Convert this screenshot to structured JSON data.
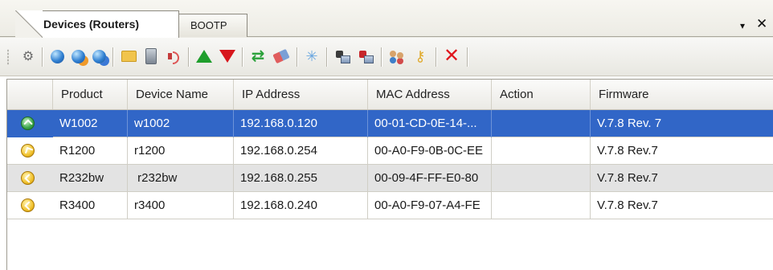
{
  "tabs": [
    {
      "label": "Devices (Routers)",
      "active": true
    },
    {
      "label": "BOOTP",
      "active": false
    }
  ],
  "window_controls": {
    "dropdown": "▾",
    "close": "✕"
  },
  "toolbar": {
    "icons": [
      "settings-tool-icon",
      "globe-icon",
      "globe-orange-icon",
      "globe-blue-icon",
      "folder-icon",
      "device-icon",
      "speaker-icon",
      "arrow-up-icon",
      "arrow-down-icon",
      "refresh-icon",
      "eraser-icon",
      "star-icon",
      "network-icon",
      "network-red-icon",
      "people-icon",
      "key-icon",
      "delete-icon"
    ]
  },
  "grid": {
    "columns": [
      "Product",
      "Device Name",
      "IP Address",
      "MAC Address",
      "Action",
      "Firmware"
    ],
    "rows": [
      {
        "status": "online",
        "product": "W1002",
        "device_name": "w1002",
        "ip": "192.168.0.120",
        "mac": "00-01-CD-0E-14-...",
        "action": "",
        "firmware": "V.7.8 Rev. 7",
        "selected": true
      },
      {
        "status": "warning",
        "product": "R1200",
        "device_name": "r1200",
        "ip": "192.168.0.254",
        "mac": "00-A0-F9-0B-0C-EE",
        "action": "",
        "firmware": "V.7.8 Rev.7",
        "selected": false
      },
      {
        "status": "warning",
        "product": "R232bw",
        "device_name": " r232bw",
        "ip": "192.168.0.255",
        "mac": "00-09-4F-FF-E0-80",
        "action": "",
        "firmware": "V.7.8 Rev.7",
        "selected": false
      },
      {
        "status": "warning",
        "product": "R3400",
        "device_name": "r3400",
        "ip": "192.168.0.240",
        "mac": "00-A0-F9-07-A4-FE",
        "action": "",
        "firmware": "V.7.8 Rev.7",
        "selected": false
      }
    ]
  },
  "colors": {
    "selection": "#3166c7",
    "alt_row": "#e3e3e3",
    "status_ok": "#3aa347",
    "status_warn": "#f1c12c"
  }
}
